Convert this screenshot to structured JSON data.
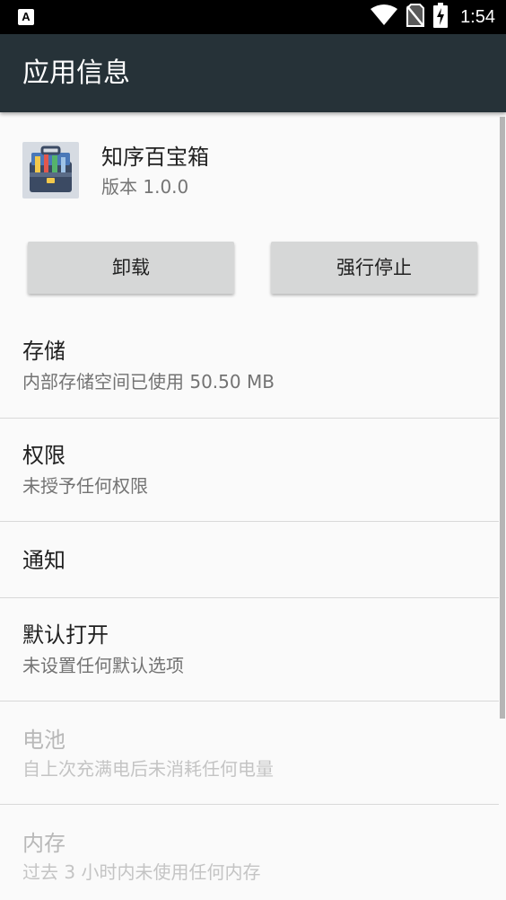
{
  "status_bar": {
    "left_icon": "A",
    "time": "1:54",
    "icons": [
      "wifi-icon",
      "no-sim-icon",
      "battery-charging-icon"
    ]
  },
  "app_bar": {
    "title": "应用信息",
    "background": "#263238"
  },
  "app": {
    "name": "知序百宝箱",
    "version": "版本 1.0.0",
    "icon": "toolbox-icon"
  },
  "buttons": {
    "uninstall": "卸载",
    "force_stop": "强行停止"
  },
  "rows": [
    {
      "title": "存储",
      "summary": "内部存储空间已使用 50.50 MB",
      "enabled": true
    },
    {
      "title": "权限",
      "summary": "未授予任何权限",
      "enabled": true
    },
    {
      "title": "通知",
      "summary": "",
      "enabled": true
    },
    {
      "title": "默认打开",
      "summary": "未设置任何默认选项",
      "enabled": true
    },
    {
      "title": "电池",
      "summary": "自上次充满电后未消耗任何电量",
      "enabled": false
    },
    {
      "title": "内存",
      "summary": "过去 3 小时内未使用任何内存",
      "enabled": false
    }
  ]
}
